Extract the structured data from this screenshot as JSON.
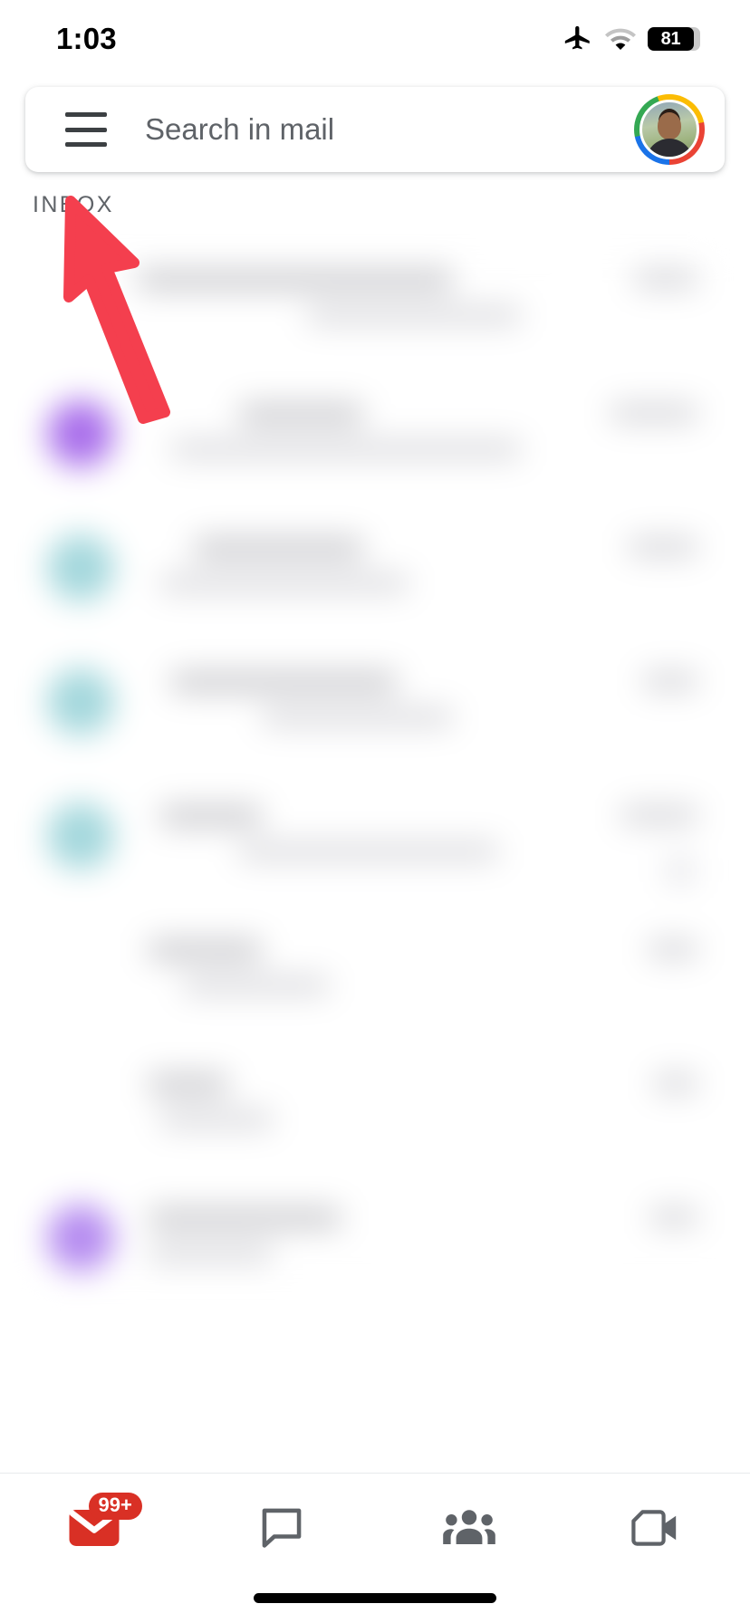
{
  "status_bar": {
    "time": "1:03",
    "airplane_icon": "airplane-mode-icon",
    "wifi_icon": "wifi-icon",
    "battery_level": "81",
    "battery_icon": "battery-icon"
  },
  "search": {
    "menu_icon": "hamburger-menu-icon",
    "placeholder": "Search in mail",
    "value": "",
    "avatar_name": "account-avatar"
  },
  "inbox": {
    "label": "INBOX"
  },
  "annotation": {
    "arrow_color": "#F43F4E",
    "arrow_name": "red-pointer-arrow",
    "points_to": "hamburger-menu-icon"
  },
  "mail_list": {
    "blurred": true,
    "rows": [
      {
        "avatar_color": "#ffffff",
        "has_avatar": false
      },
      {
        "avatar_color": "#A96EEB",
        "has_avatar": true
      },
      {
        "avatar_color": "#A3D7DC",
        "has_avatar": true
      },
      {
        "avatar_color": "#A3D7DC",
        "has_avatar": true
      },
      {
        "avatar_color": "#A3D7DC",
        "has_avatar": true
      },
      {
        "avatar_color": "#ffffff",
        "has_avatar": false
      },
      {
        "avatar_color": "#ffffff",
        "has_avatar": false
      },
      {
        "avatar_color": "#B58BF0",
        "has_avatar": true
      },
      {
        "avatar_color": "#C4D8F0",
        "has_avatar": true
      }
    ]
  },
  "bottom_nav": {
    "items": [
      {
        "label": "Mail",
        "icon": "mail-icon",
        "badge": "99+",
        "active": true
      },
      {
        "label": "Chat",
        "icon": "chat-bubble-icon",
        "badge": "",
        "active": false
      },
      {
        "label": "Spaces",
        "icon": "people-group-icon",
        "badge": "",
        "active": false
      },
      {
        "label": "Meet",
        "icon": "video-camera-icon",
        "badge": "",
        "active": false
      }
    ],
    "active_color": "#D93025",
    "inactive_color": "#5F6368"
  },
  "home_indicator": {
    "name": "home-indicator"
  }
}
